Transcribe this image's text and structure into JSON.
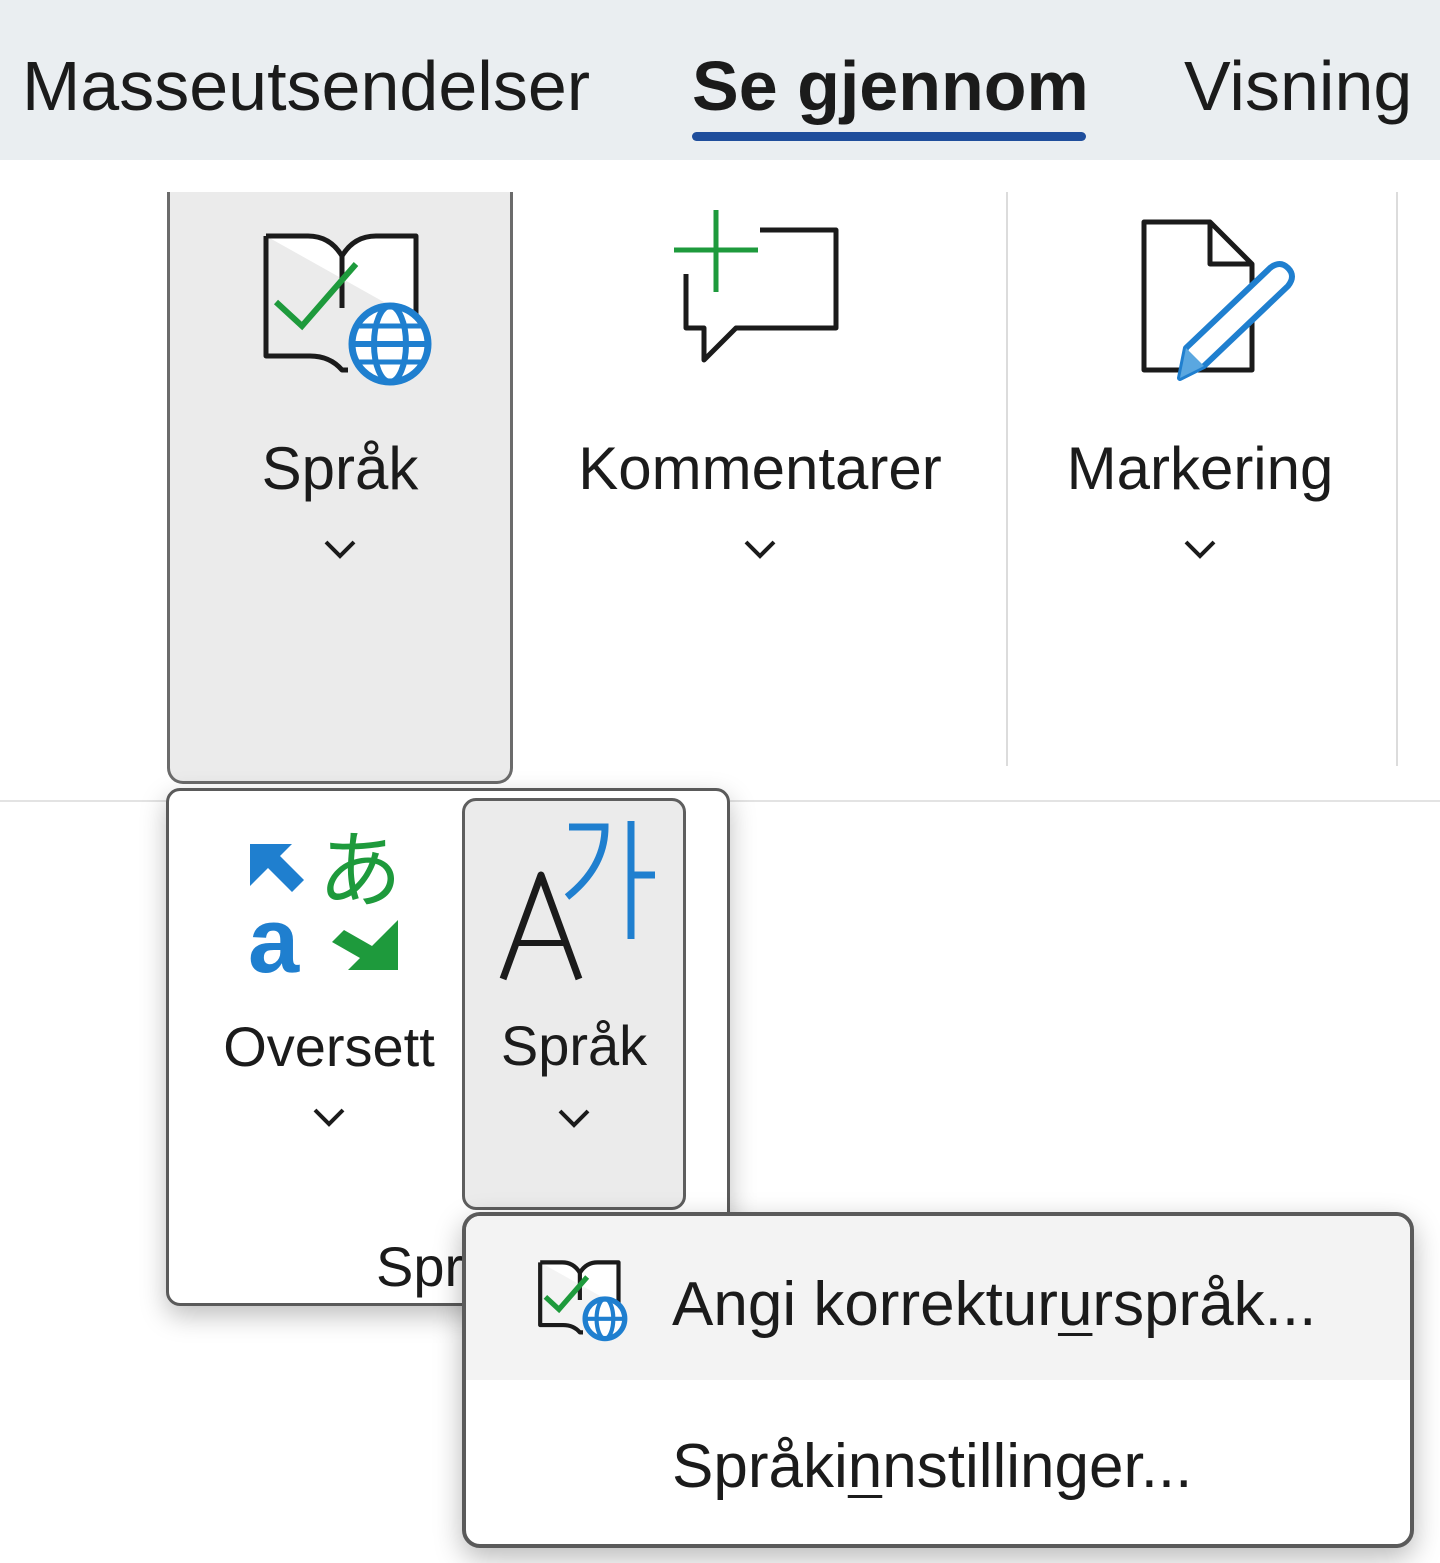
{
  "tabs": [
    {
      "label": "Masseutsendelser"
    },
    {
      "label": "Se gjennom",
      "active": true
    },
    {
      "label": "Visning"
    }
  ],
  "ribbon": {
    "language_button": {
      "label": "Språk",
      "icon": "book-check-globe-icon"
    },
    "comments_button": {
      "label": "Kommentarer",
      "icon": "new-comment-icon"
    },
    "markup_button": {
      "label": "Markering",
      "icon": "document-pencil-icon"
    }
  },
  "language_flyout": {
    "translate_button": {
      "label": "Oversett",
      "icon": "translate-icon"
    },
    "language_button": {
      "label": "Språk",
      "icon": "language-a-ga-icon"
    },
    "group_label": "Spr"
  },
  "language_menu": {
    "items": [
      {
        "label_before": "Angi korrektur",
        "accel": "u",
        "label_after": "rspråk...",
        "icon": "book-check-globe-icon"
      },
      {
        "label_before": "Språki",
        "accel": "n",
        "label_after": "nstillinger...",
        "icon": ""
      }
    ]
  },
  "colors": {
    "accent": "#1f4e9c",
    "green": "#1e9a3c",
    "blue": "#1f7fcf",
    "pressed_bg": "#ebebeb",
    "tabbar_bg": "#eaeef1"
  }
}
